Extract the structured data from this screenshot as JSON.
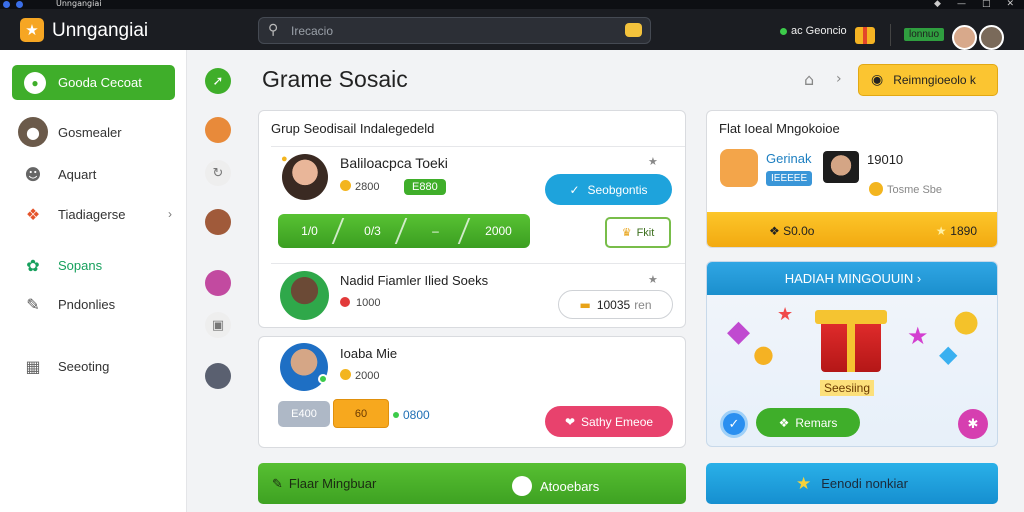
{
  "window": {
    "title": "Unngangiai"
  },
  "titlebar": {
    "app_name": "Unngangiai",
    "search_placeholder": "Irecacio",
    "status_text": "ac Geoncio",
    "badge": "lonnuo",
    "colors": {
      "bar": "#1b1d22",
      "logo": "#f6a623"
    }
  },
  "sidebar": {
    "primary_label": "Gooda Cecoat",
    "items": [
      {
        "label": "Gosmealer",
        "icon": "user-avatar-icon"
      },
      {
        "label": "Aquart",
        "icon": "people-icon"
      },
      {
        "label": "Tiadiagerse",
        "icon": "puzzle-icon",
        "has_chevron": true
      },
      {
        "label": "Sopans",
        "icon": "leaf-icon",
        "active": true
      },
      {
        "label": "Pndonlies",
        "icon": "edit-icon"
      },
      {
        "label": "Seeoting",
        "icon": "building-icon"
      }
    ]
  },
  "header": {
    "title": "Grame Sosaic",
    "action_label": "Reimngioeolo k"
  },
  "group": {
    "title": "Grup Seodisail Indalegedeld",
    "members": [
      {
        "name": "Baliloacpca Toeki",
        "coins": "2800",
        "chip": "E880",
        "action": "Seobgontis",
        "segments": [
          "1/0",
          "0/3",
          "–",
          "2000"
        ],
        "small_action": "Fkit"
      },
      {
        "name": "Nadid Fiamler Ilied Soeks",
        "points": "1000",
        "pill_value": "10035",
        "pill_suffix": "ren"
      },
      {
        "name": "Ioaba Mie",
        "coins": "2000",
        "chip_gray": "E400",
        "chip_orange": "60",
        "status_value": "0800",
        "action": "Sathy Emeoe"
      }
    ]
  },
  "flat_card": {
    "title": "Flat Ioeal Mngokoioe",
    "player1": {
      "name": "Gerinak",
      "tag": "IEEEEE"
    },
    "player2": {
      "score": "19010",
      "sub": "Tosme Sbe"
    },
    "bar_left": "S0.0o",
    "bar_right": "1890"
  },
  "bonus": {
    "title": "HADIAH MINGOUUIN",
    "gift_label": "Seesiing",
    "button": "Remars"
  },
  "bottom": {
    "green_left": "Flaar Mingbuar",
    "green_right": "Atooebars",
    "blue": "Eenodi nonkiar"
  }
}
